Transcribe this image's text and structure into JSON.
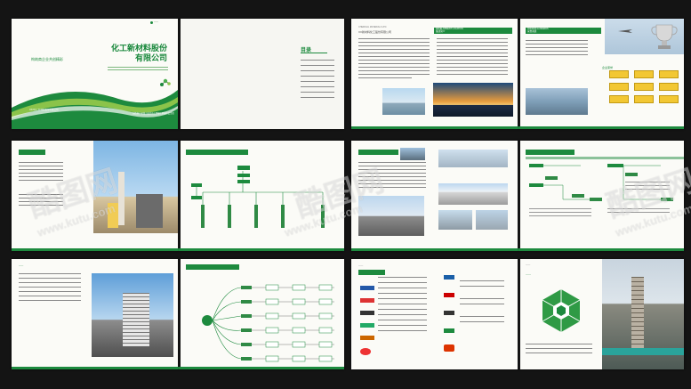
{
  "cover": {
    "title_line1": "化工新材料股份",
    "title_line2": "有限公司",
    "subtitle": "构筑商企业共创精彩",
    "slogan": "创造客户价值 | 成就员工梦想 | 承担社会责任",
    "footer": "ХХХ化工新材料股份有限公司"
  },
  "toc": {
    "title": "目录"
  },
  "about": {
    "company": "ХХ新材料化工股份有限公司",
    "section": "集团简介",
    "header_en": "CHEMICAL MATERIALS LTD.",
    "location_label": "DEVELOPMENT LOCATION"
  },
  "honors": {
    "header_en": "HONORS & AWARDS",
    "section": "荣誉资质",
    "sub": "企业荣誉"
  },
  "watermark": {
    "brand": "酷图网",
    "url": "www.kutu.com"
  },
  "colors": {
    "brand_green": "#1d8a3e",
    "award_yellow": "#f2c733",
    "background": "#141414"
  },
  "icons": [
    "company-logo-icon",
    "molecule-icon",
    "trophy-icon",
    "airplane-icon",
    "brand-logo-icon"
  ]
}
